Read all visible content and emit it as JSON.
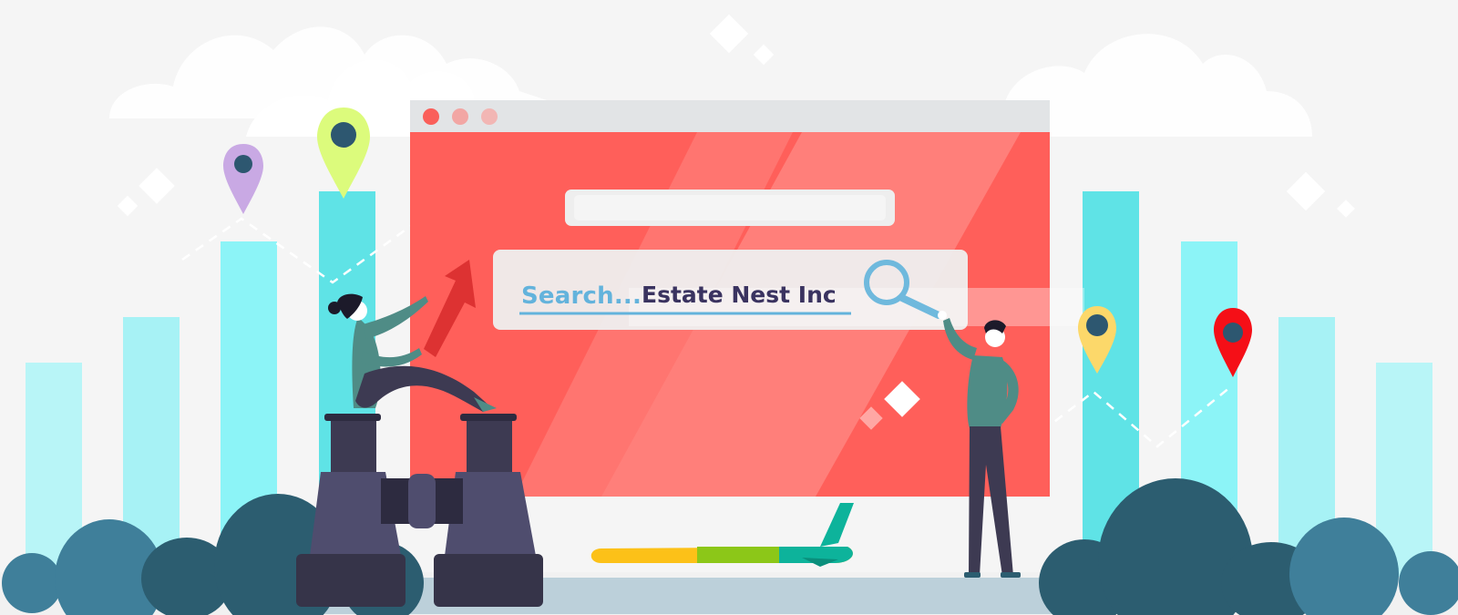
{
  "search": {
    "placeholder": "Search...",
    "query": "Estate Nest Inc"
  },
  "colors": {
    "background": "#f5f5f5",
    "browser_body": "#ff5f5a",
    "browser_bar": "#e2e4e6",
    "cyan_bar": "#5fe3e6",
    "light_cyan_bar": "#8cf4f7",
    "pale_cyan_bar": "#b5f5f6",
    "bush_dark": "#2c5d70",
    "bush_mid": "#3f7f9a",
    "search_text": "#63b3dc",
    "query_text": "#3a3360",
    "arrow": "#dd3232",
    "binoculars": "#4f4d6e",
    "plane_yellow": "#fcc118",
    "plane_green": "#8cc718",
    "plane_teal": "#0db39b"
  },
  "pins": [
    {
      "name": "purple",
      "color": "#c9a9e4"
    },
    {
      "name": "lime",
      "color": "#dcfb7c"
    },
    {
      "name": "yellow",
      "color": "#fcd86a"
    },
    {
      "name": "red",
      "color": "#f50f17"
    }
  ],
  "icons": [
    "magnifier-icon",
    "location-pin-icon",
    "arrow-up-icon",
    "binoculars-icon",
    "airplane-icon"
  ]
}
